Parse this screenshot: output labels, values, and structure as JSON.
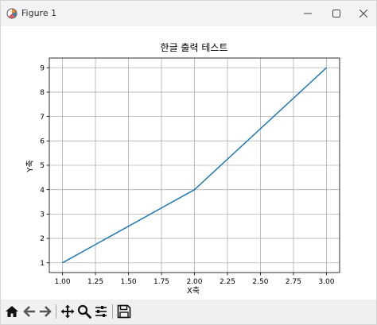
{
  "window": {
    "title": "Figure 1",
    "app_icon": "matplotlib-icon",
    "controls": [
      "minimize-icon",
      "maximize-icon",
      "close-icon"
    ]
  },
  "toolbar": {
    "buttons": [
      {
        "name": "home-button",
        "icon": "home-icon"
      },
      {
        "name": "back-button",
        "icon": "arrow-left-icon"
      },
      {
        "name": "forward-button",
        "icon": "arrow-right-icon"
      },
      {
        "name": "pan-button",
        "icon": "move-icon"
      },
      {
        "name": "zoom-button",
        "icon": "magnifier-icon"
      },
      {
        "name": "configure-subplots-button",
        "icon": "sliders-icon"
      },
      {
        "name": "save-button",
        "icon": "floppy-disk-icon"
      }
    ]
  },
  "colors": {
    "line": "#1f77b4",
    "grid": "#b0b0b0",
    "axes": "#000000",
    "titlebar": "#f3f3f3",
    "toolbar": "#f0f0f0"
  },
  "chart_data": {
    "type": "line",
    "title": "한글 출력 테스트",
    "xlabel": "X축",
    "ylabel": "Y축",
    "series": [
      {
        "x": [
          1,
          2,
          3
        ],
        "y": [
          1,
          4,
          9
        ]
      }
    ],
    "xlim": [
      0.9,
      3.1
    ],
    "ylim": [
      0.6,
      9.4
    ],
    "xticks": [
      "1.00",
      "1.25",
      "1.50",
      "1.75",
      "2.00",
      "2.25",
      "2.50",
      "2.75",
      "3.00"
    ],
    "yticks": [
      "1",
      "2",
      "3",
      "4",
      "5",
      "6",
      "7",
      "8",
      "9"
    ],
    "grid": true
  }
}
